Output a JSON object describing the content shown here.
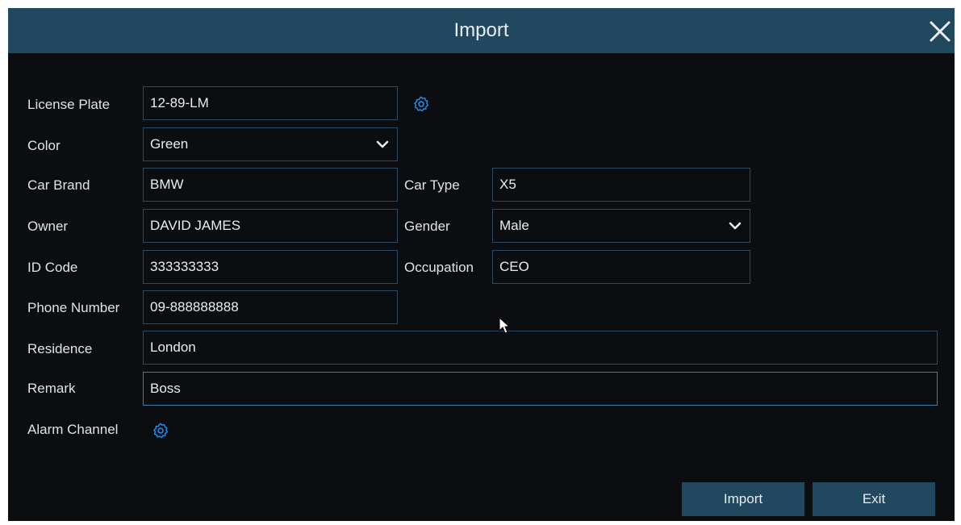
{
  "dialog": {
    "title": "Import"
  },
  "form": {
    "license_plate": {
      "label": "License Plate",
      "value": "12-89-LM"
    },
    "color": {
      "label": "Color",
      "value": "Green"
    },
    "car_brand": {
      "label": "Car Brand",
      "value": "BMW"
    },
    "car_type": {
      "label": "Car Type",
      "value": "X5"
    },
    "owner": {
      "label": "Owner",
      "value": "DAVID JAMES"
    },
    "gender": {
      "label": "Gender",
      "value": "Male"
    },
    "id_code": {
      "label": "ID Code",
      "value": "333333333"
    },
    "occupation": {
      "label": "Occupation",
      "value": "CEO"
    },
    "phone_number": {
      "label": "Phone Number",
      "value": "09-888888888"
    },
    "residence": {
      "label": "Residence",
      "value": "London"
    },
    "remark": {
      "label": "Remark",
      "value": "Boss"
    },
    "alarm_channel": {
      "label": "Alarm Channel"
    }
  },
  "buttons": {
    "import_label": "Import",
    "exit_label": "Exit"
  },
  "colors": {
    "title_bar": "#22485f",
    "background": "#0b0d10",
    "field_border": "#2a4a66",
    "icon_accent": "#1e8ff0"
  }
}
